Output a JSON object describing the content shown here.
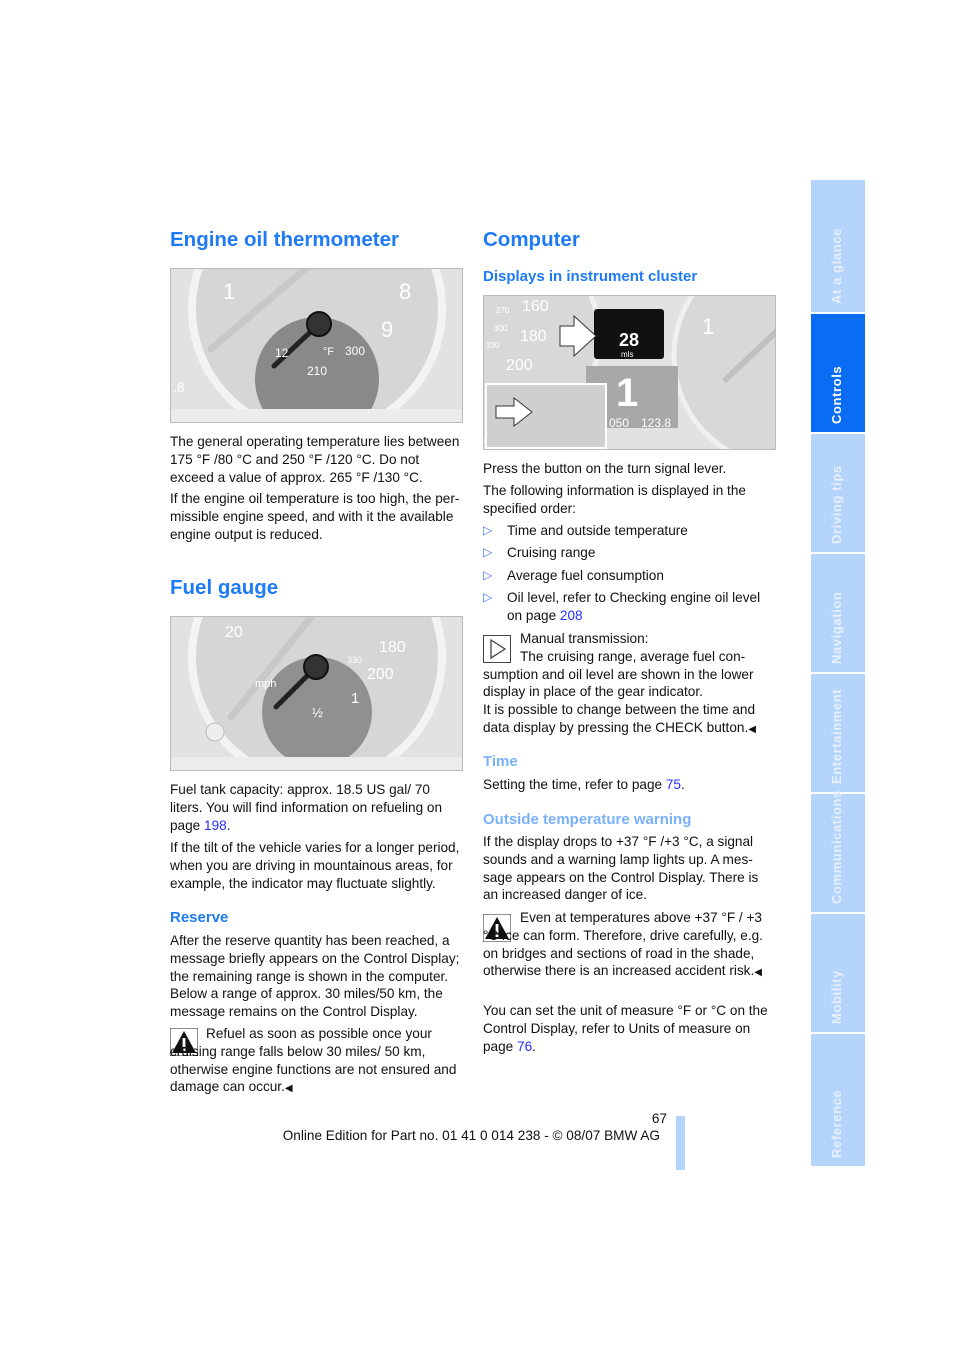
{
  "left": {
    "engine_oil": {
      "title": "Engine oil thermometer",
      "figure": {
        "labels": [
          "1",
          "8",
          "9",
          "12",
          "°F",
          "300",
          "210",
          ".8"
        ]
      },
      "p1": "The general operating temperature lies between 175 °F /80 °C and 250 °F /120 °C. Do not exceed a value of approx. 265 °F /130 °C.",
      "p2": "If the engine oil temperature is too high, the per­missible engine speed, and with it the available engine output is reduced."
    },
    "fuel_gauge": {
      "title": "Fuel gauge",
      "figure": {
        "labels": [
          "20",
          "mph",
          "180",
          "200",
          "330",
          "1",
          "½"
        ]
      },
      "p1_pre": "Fuel tank capacity: approx. 18.5 US gal/ 70 liters. You will find information on refueling on page ",
      "p1_link": "198",
      "p1_post": ".",
      "p2": "If the tilt of the vehicle varies for a longer period, when you are driving in mountainous areas, for example, the indicator may fluctuate slightly."
    },
    "reserve": {
      "title": "Reserve",
      "p1": "After the reserve quantity has been reached, a message briefly appears on the Control Display; the remaining range is shown in the computer. Below a range of approx. 30 miles/50 km, the message remains on the Control Display.",
      "warning": "Refuel as soon as possible once your cruising range falls below 30 miles/ 50 km, otherwise engine functions are not ensured and damage can occur."
    }
  },
  "right": {
    "computer": {
      "title": "Computer",
      "subtitle": "Displays in instrument cluster",
      "figure": {
        "labels": [
          "160",
          "180",
          "200",
          "270",
          "300",
          "330",
          "28",
          "mls",
          "1",
          "050",
          "123.8"
        ]
      },
      "p1": "Press the button on the turn signal lever.",
      "p2": "The following information is displayed in the specified order:",
      "bullets": [
        "Time and outside temperature",
        "Cruising range",
        "Average fuel consumption"
      ],
      "bullet4_pre": "Oil level, refer to Checking engine oil level on page ",
      "bullet4_link": "208",
      "note_lead": "Manual transmission:",
      "note": "The cruising range, average fuel con­sumption and oil level are shown in the lower display in place of the gear indicator.",
      "note2": "It is possible to change between the time and data display by pressing the CHECK button."
    },
    "time": {
      "title": "Time",
      "p_pre": "Setting the time, refer to page ",
      "p_link": "75",
      "p_post": "."
    },
    "outside": {
      "title": "Outside temperature warning",
      "p1": "If the display drops to +37 °F /+3 °C, a signal sounds and a warning lamp lights up. A mes­sage appears on the Control Display. There is an increased danger of ice.",
      "warning": "Even at temperatures above +37 °F / +3 °C ice can form. Therefore, drive care­fully, e.g. on bridges and sections of road in the shade, otherwise there is an increased accident risk.",
      "p2_pre": "You can set the unit of measure °F or °C on the Control Display, refer to Units of measure on page ",
      "p2_link": "76",
      "p2_post": "."
    }
  },
  "footer": {
    "page_number": "67",
    "edition": "Online Edition for Part no. 01 41 0 014 238 - © 08/07 BMW AG"
  },
  "sidebar": {
    "active": "Controls",
    "tabs": [
      "At a glance",
      "Controls",
      "Driving tips",
      "Navigation",
      "Entertainment",
      "Communications",
      "Mobility",
      "Reference"
    ]
  },
  "colors": {
    "heading": "#1f7bf5",
    "tab": "#b5d4fb",
    "tab_active": "#0a6cf5",
    "link": "#2430ff"
  }
}
